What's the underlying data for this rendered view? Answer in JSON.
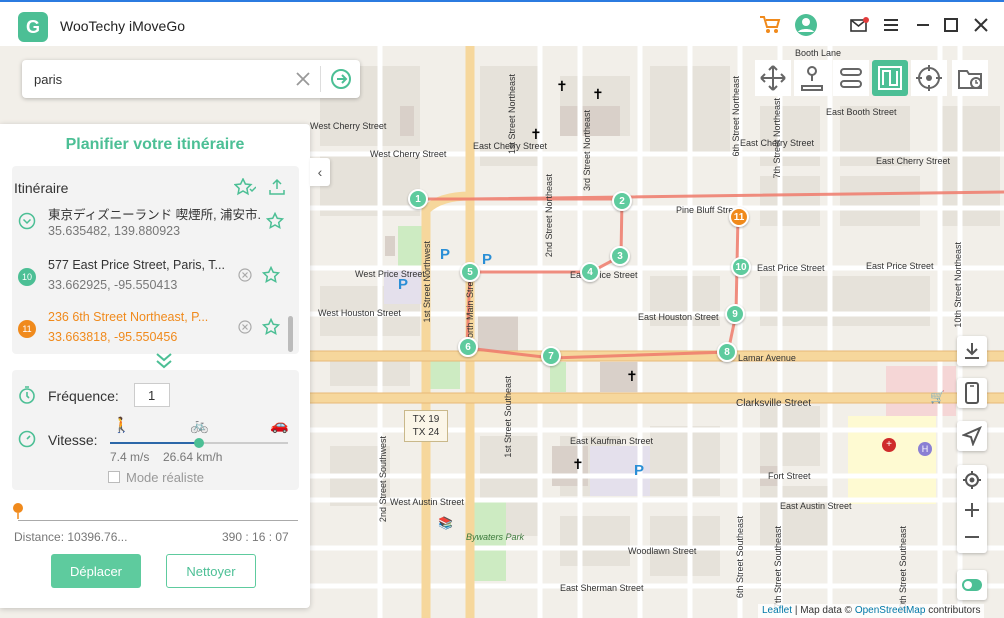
{
  "app": {
    "title": "WooTechy iMoveGo"
  },
  "search": {
    "value": "paris"
  },
  "panel": {
    "title": "Planifier votre itinéraire",
    "route_heading": "Itinéraire",
    "items": [
      {
        "number": "",
        "name": "東京ディズニーランド 喫煙所, 浦安市...",
        "coords": "35.635482, 139.880923"
      },
      {
        "number": "10",
        "name": "577 East Price Street, Paris, T...",
        "coords": "33.662925, -95.550413"
      },
      {
        "number": "11",
        "name": "236 6th Street Northeast, P...",
        "coords": "33.663818, -95.550456"
      }
    ],
    "frequency_label": "Fréquence:",
    "frequency_value": "1",
    "speed_label": "Vitesse:",
    "speed_ms": "7.4 m/s",
    "speed_kmh": "26.64 km/h",
    "speed_fraction": 0.5,
    "realistic_mode": "Mode réaliste",
    "distance": "Distance: 10396.76...",
    "time": "390 : 16 : 07",
    "move_button": "Déplacer",
    "clear_button": "Nettoyer"
  },
  "map": {
    "street_labels": [
      "West Cherry Street",
      "East Cherry Street",
      "East Cherry Street",
      "East Cherry Street",
      "Pine Bluff Street",
      "East Booth Street",
      "Booth Lane",
      "East Price Street",
      "East Price Street",
      "East Price Street",
      "West Price Street",
      "West Houston Street",
      "East Houston Street",
      "Lamar Avenue",
      "Clarksville Street",
      "East Kaufman Street",
      "Fort Street",
      "East Austin Street",
      "West Austin Street",
      "Woodlawn Street",
      "East Sherman Street",
      "Bywaters Park",
      "1st Street Northwest",
      "North Main Street",
      "1st Street Northeast",
      "2nd Street Northeast",
      "3rd Street Northeast",
      "6th Street Northeast",
      "7th Street Northeast",
      "10th Street Northeast",
      "2nd Street Southwest",
      "1st Street Southeast",
      "6th Street Southeast",
      "7th Street Southeast",
      "10th Street Southeast",
      "West Cherry Street"
    ],
    "shields": [
      "TX 19",
      "TX 24"
    ],
    "waypoints": [
      "1",
      "2",
      "3",
      "4",
      "5",
      "6",
      "7",
      "8",
      "9",
      "10",
      "11"
    ],
    "attribution_leaflet": "Leaflet",
    "attribution_rest": "| Map data ©",
    "attribution_osm": "OpenStreetMap",
    "attribution_end": "contributors"
  }
}
